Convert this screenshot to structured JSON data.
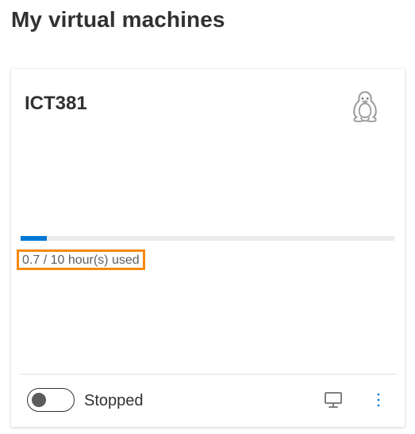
{
  "page": {
    "title": "My virtual machines"
  },
  "vm_card": {
    "name": "ICT381",
    "os_icon": "linux-penguin-icon",
    "quota": {
      "used_hours": 0.7,
      "total_hours": 10,
      "fraction_used": 0.07,
      "label": "0.7 / 10 hour(s) used"
    },
    "state": {
      "running": false,
      "label": "Stopped"
    },
    "actions": {
      "connect_icon": "monitor-icon",
      "more_icon": "more-vertical-icon"
    }
  },
  "colors": {
    "title": "#323130",
    "progress_fill": "#0078d4",
    "progress_track": "#ececec",
    "highlight_border": "#f7890f",
    "muted_text": "#605e5c",
    "action_blue": "#0078d4"
  }
}
